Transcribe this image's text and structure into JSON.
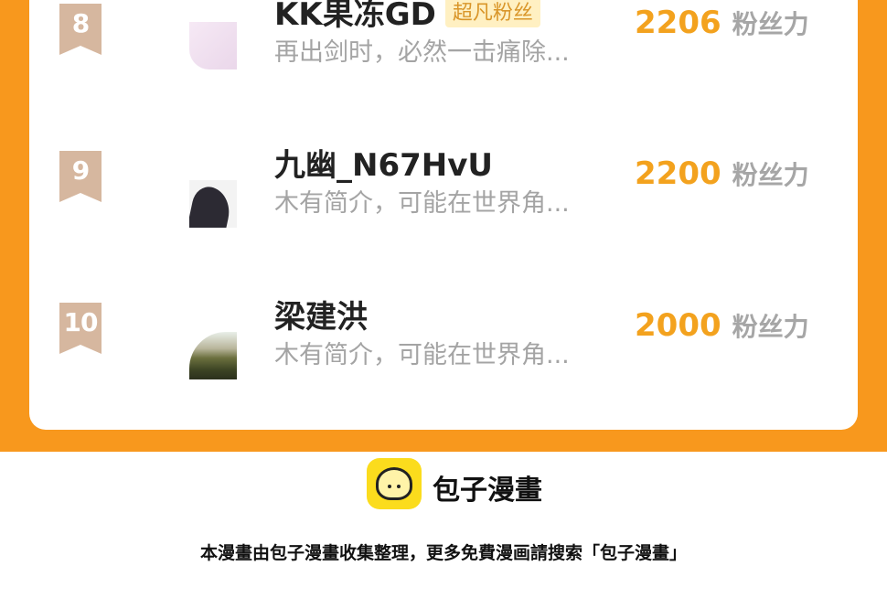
{
  "ranking": {
    "entries": [
      {
        "rank": "8",
        "name": "KK果冻GD",
        "tag": "超凡粉丝",
        "bio": "再出剑时，必然一击痛除...",
        "score": "2206",
        "score_unit": "粉丝力"
      },
      {
        "rank": "9",
        "name": "九幽_N67HvU",
        "tag": "",
        "bio": "木有简介，可能在世界角...",
        "score": "2200",
        "score_unit": "粉丝力"
      },
      {
        "rank": "10",
        "name": "梁建洪",
        "tag": "",
        "bio": "木有简介，可能在世界角...",
        "score": "2000",
        "score_unit": "粉丝力"
      }
    ]
  },
  "footer": {
    "brand": "包子漫畫",
    "note": "本漫畫由包子漫畫收集整理，更多免費漫画請搜索「包子漫畫」"
  },
  "colors": {
    "frame": "#f8981d",
    "score": "#f3a21e",
    "badge": "#d6b79f",
    "tag_bg": "#fff0c2",
    "logo_bg": "#fbdc1d"
  }
}
